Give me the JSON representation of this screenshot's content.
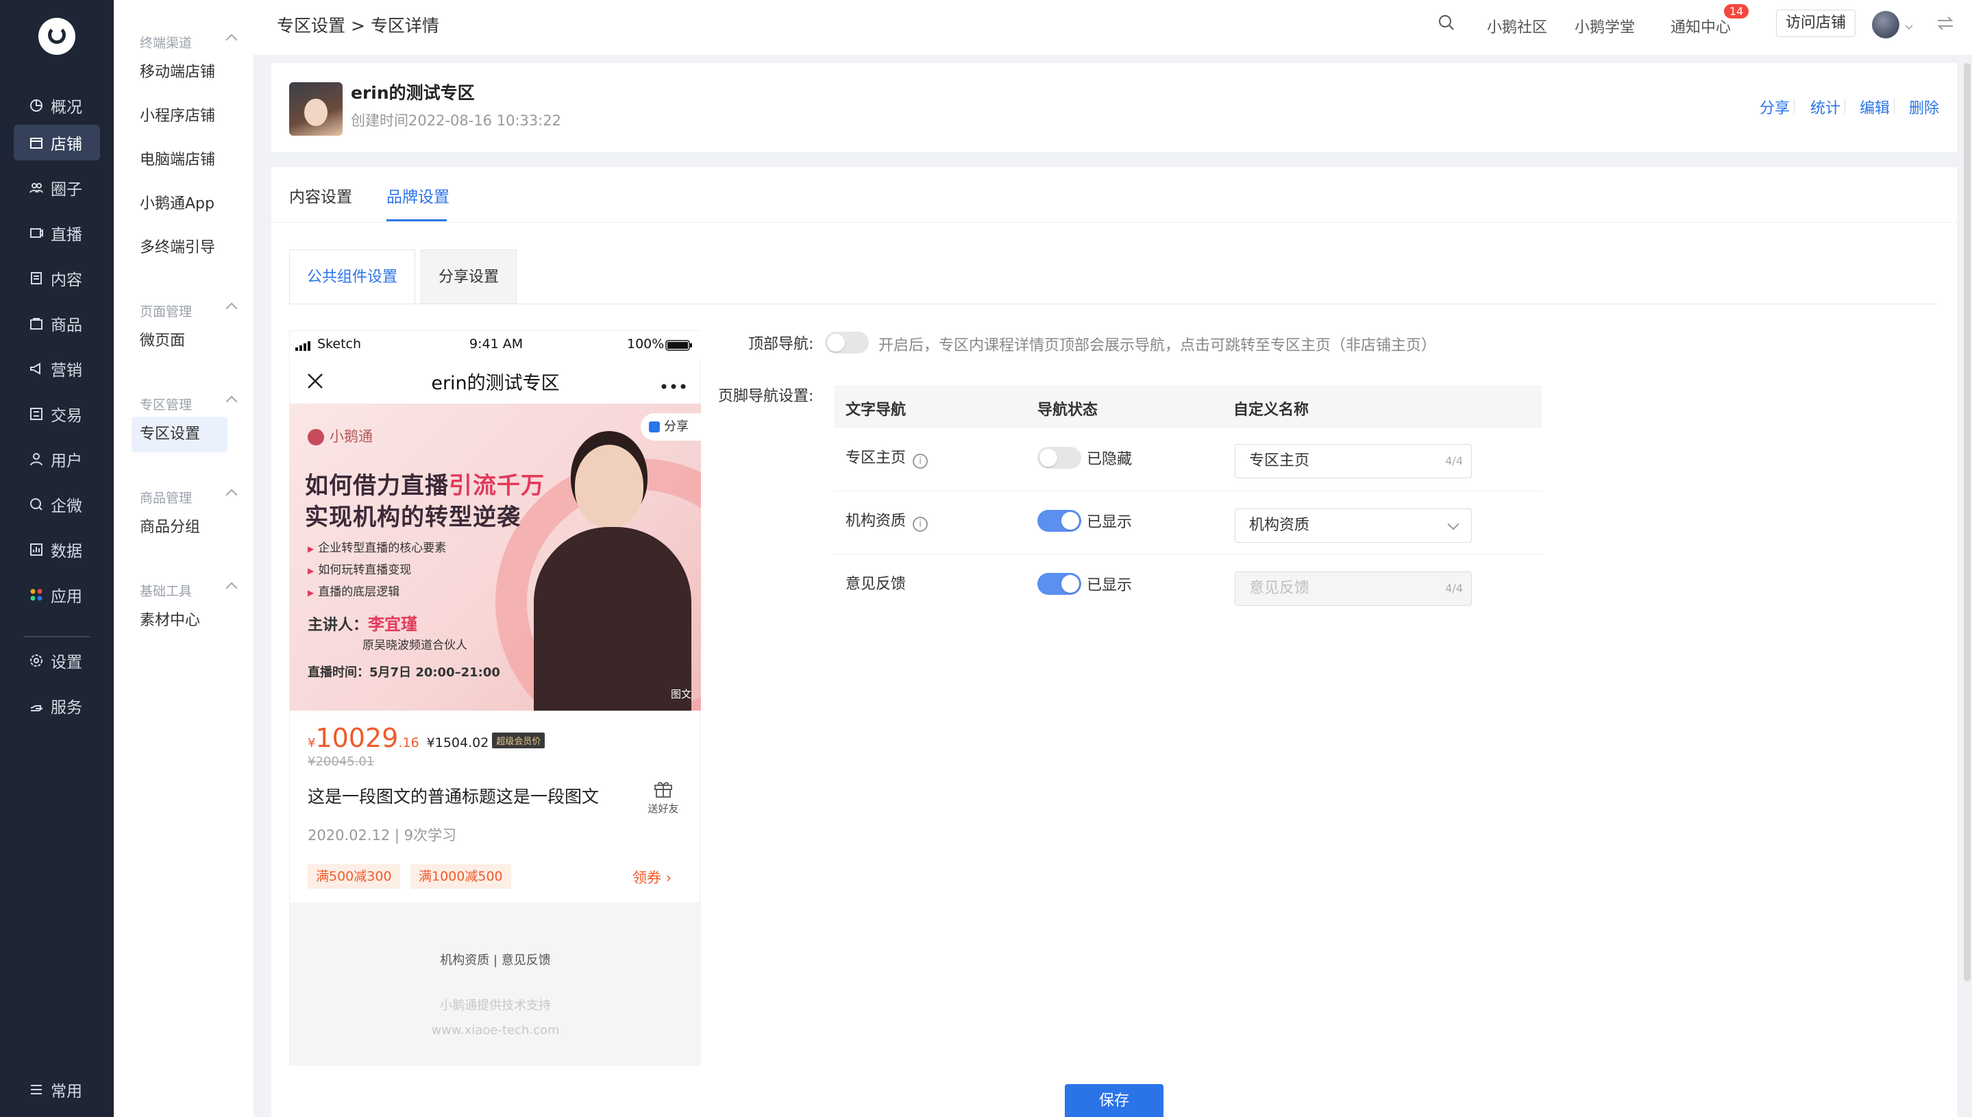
{
  "sidebar": {
    "items": [
      {
        "label": "概况",
        "icon": "pie-chart-icon"
      },
      {
        "label": "店铺",
        "icon": "store-icon"
      },
      {
        "label": "圈子",
        "icon": "group-icon"
      },
      {
        "label": "直播",
        "icon": "live-icon"
      },
      {
        "label": "内容",
        "icon": "document-icon"
      },
      {
        "label": "商品",
        "icon": "product-icon"
      },
      {
        "label": "营销",
        "icon": "megaphone-icon"
      },
      {
        "label": "交易",
        "icon": "transaction-icon"
      },
      {
        "label": "用户",
        "icon": "user-icon"
      },
      {
        "label": "企微",
        "icon": "wecom-icon"
      },
      {
        "label": "数据",
        "icon": "data-icon"
      },
      {
        "label": "应用",
        "icon": "apps-icon"
      },
      {
        "label": "设置",
        "icon": "gear-icon"
      },
      {
        "label": "服务",
        "icon": "service-icon"
      }
    ],
    "bottom_label": "常用",
    "active": "店铺"
  },
  "submenu": {
    "groups": [
      {
        "title": "终端渠道",
        "items": [
          "移动端店铺",
          "小程序店铺",
          "电脑端店铺",
          "小鹅通App",
          "多终端引导"
        ]
      },
      {
        "title": "页面管理",
        "items": [
          "微页面"
        ]
      },
      {
        "title": "专区管理",
        "items": [
          "专区设置"
        ]
      },
      {
        "title": "商品管理",
        "items": [
          "商品分组"
        ]
      },
      {
        "title": "基础工具",
        "items": [
          "素材中心"
        ]
      }
    ],
    "active": "专区设置"
  },
  "topbar": {
    "breadcrumb": "专区设置 > 专区详情",
    "links": [
      "小鹅社区",
      "小鹅学堂",
      "通知中心"
    ],
    "notify_count": "14",
    "visit_button": "访问店铺"
  },
  "header": {
    "title": "erin的测试专区",
    "created": "创建时间2022-08-16 10:33:22",
    "actions": [
      "分享",
      "统计",
      "编辑",
      "删除"
    ]
  },
  "tabs": [
    "内容设置",
    "品牌设置"
  ],
  "active_tab": "品牌设置",
  "subtabs": [
    "公共组件设置",
    "分享设置"
  ],
  "active_subtab": "公共组件设置",
  "phone": {
    "status_left": "Sketch",
    "status_time": "9:41 AM",
    "status_battery": "100%",
    "nav_title": "erin的测试专区",
    "share": "分享",
    "brand": "小鹅通",
    "headline_1a": "如何借力直播",
    "headline_1b": "引流千万",
    "headline_2": "实现机构的转型逆袭",
    "bullets": [
      "企业转型直播的核心要素",
      "如何玩转直播变现",
      "直播的底层逻辑"
    ],
    "speaker_prefix": "主讲人：",
    "speaker_name": "李宜瑾",
    "speaker_title": "原吴晓波频道合伙人",
    "live_time": "直播时间：5月7日 20:00–21:00",
    "image_tag": "图文",
    "price_yen": "¥",
    "price_int": "10029",
    "price_dec": ".16",
    "price_member": "¥1504.02",
    "member_tag": "超级会员价",
    "price_old": "¥20045.01",
    "course_title": "这是一段图文的普通标题这是一段图文",
    "gift_label": "送好友",
    "course_meta": "2020.02.12 | 9次学习",
    "coupons": [
      "满500减300",
      "满1000减500"
    ],
    "get_coupon": "领券",
    "footer_links": "机构资质   |   意见反馈",
    "footer_tech": "小鹅通提供技术支持",
    "footer_url": "www.xiaoe-tech.com"
  },
  "settings": {
    "top_nav_label": "顶部导航:",
    "top_nav_enabled": false,
    "top_nav_hint": "开启后，专区内课程详情页顶部会展示导航，点击可跳转至专区主页（非店铺主页）",
    "footer_nav_label": "页脚导航设置:",
    "columns": [
      "文字导航",
      "导航状态",
      "自定义名称"
    ],
    "rows": [
      {
        "name": "专区主页",
        "info": true,
        "enabled": false,
        "status": "已隐藏",
        "value": "专区主页",
        "count": "4/4",
        "type": "input"
      },
      {
        "name": "机构资质",
        "info": true,
        "enabled": true,
        "status": "已显示",
        "value": "机构资质",
        "count": "",
        "type": "select"
      },
      {
        "name": "意见反馈",
        "info": false,
        "enabled": true,
        "status": "已显示",
        "value": "意见反馈",
        "count": "4/4",
        "type": "disabled"
      }
    ],
    "save_button": "保存"
  },
  "colors": {
    "sidebar_bg": "#1e2534",
    "accent": "#2a74e8",
    "price": "#f05a2a",
    "switch_on": "#5b8ff0"
  }
}
